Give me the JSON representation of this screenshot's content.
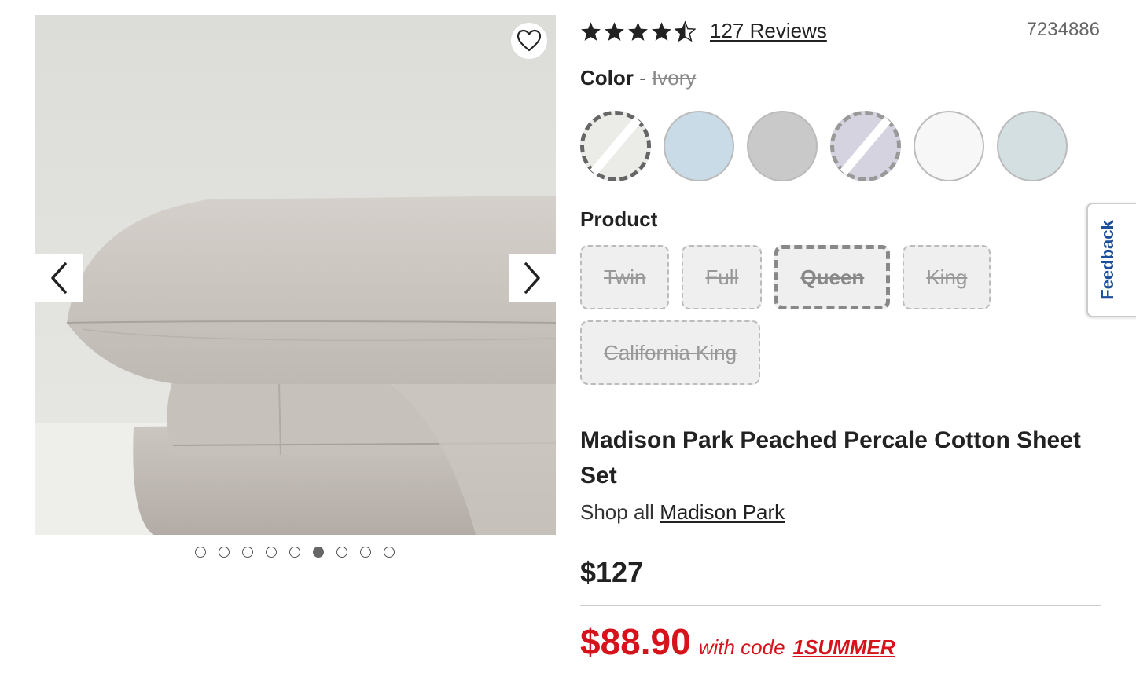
{
  "gallery": {
    "image_alt": "Madison Park Peached Percale Cotton Sheet Set",
    "dots_count": 9,
    "active_dot": 6
  },
  "icons": {
    "wishlist": "heart-icon",
    "prev": "chevron-left-icon",
    "next": "chevron-right-icon",
    "star": "star-icon"
  },
  "rating": {
    "value": 4.5,
    "reviews_label": "127 Reviews"
  },
  "sku": "7234886",
  "color": {
    "label": "Color",
    "separator": "-",
    "selected_value": "Ivory",
    "swatches": [
      {
        "hex": "#ebebe7",
        "disabled": true,
        "selected": true
      },
      {
        "hex": "#c9dbe6",
        "disabled": false,
        "selected": false
      },
      {
        "hex": "#c9c9c9",
        "disabled": false,
        "selected": false
      },
      {
        "hex": "#d6d3e0",
        "disabled": true,
        "selected": false
      },
      {
        "hex": "#f7f7f7",
        "disabled": false,
        "selected": false
      },
      {
        "hex": "#d3dfe0",
        "disabled": false,
        "selected": false
      }
    ]
  },
  "product": {
    "label": "Product",
    "sizes": [
      {
        "label": "Twin",
        "selected": false
      },
      {
        "label": "Full",
        "selected": false
      },
      {
        "label": "Queen",
        "selected": true
      },
      {
        "label": "King",
        "selected": false
      },
      {
        "label": "California King",
        "selected": false
      }
    ]
  },
  "title": "Madison Park Peached Percale Cotton Sheet Set",
  "shop_all": {
    "prefix": "Shop all",
    "brand": "Madison Park"
  },
  "price": {
    "original": "$127",
    "sale": "$88.90",
    "with_code_label": "with code",
    "promo_code": "1SUMMER"
  },
  "feedback_label": "Feedback",
  "colors": {
    "sale_red": "#d6121b",
    "feedback_blue": "#1b4f9c"
  }
}
